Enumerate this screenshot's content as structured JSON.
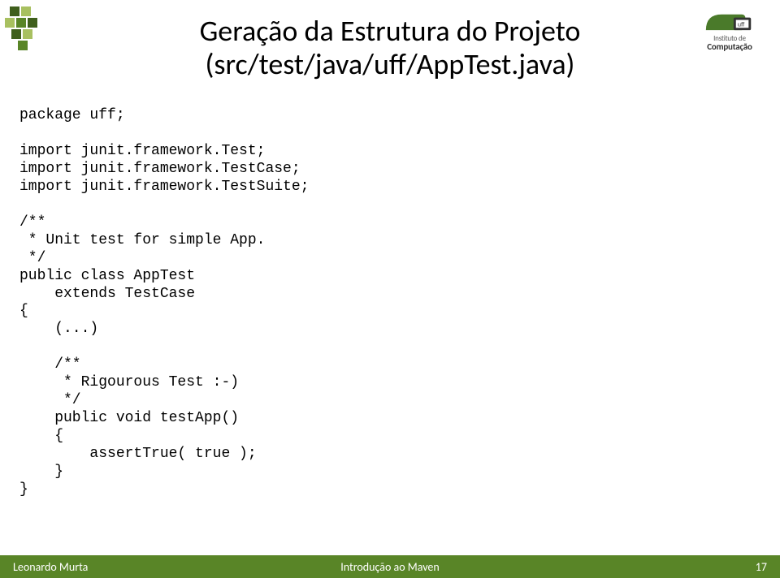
{
  "title_line1": "Geração da Estrutura do Projeto",
  "title_line2": "(src/test/java/uff/AppTest.java)",
  "code_lines": [
    "package uff;",
    "",
    "import junit.framework.Test;",
    "import junit.framework.TestCase;",
    "import junit.framework.TestSuite;",
    "",
    "/**",
    " * Unit test for simple App.",
    " */",
    "public class AppTest ",
    "    extends TestCase",
    "{",
    "    (...)",
    "",
    "    /**",
    "     * Rigourous Test :-)",
    "     */",
    "    public void testApp()",
    "    {",
    "        assertTrue( true );",
    "    }",
    "}"
  ],
  "logo_right_line1": "Instituto de",
  "logo_right_line2": "Computação",
  "footer": {
    "left": "Leonardo Murta",
    "center": "Introdução ao Maven",
    "right": "17"
  },
  "colors": {
    "accent": "#598527",
    "accent_dark": "#3f5f1c",
    "accent_light": "#a8c060"
  }
}
